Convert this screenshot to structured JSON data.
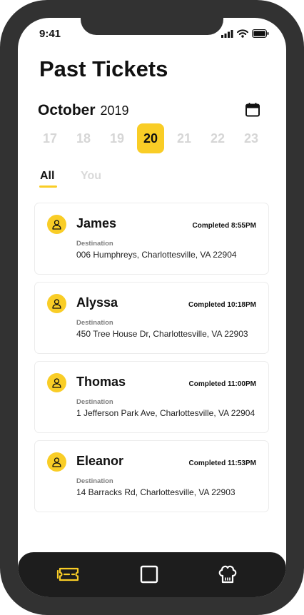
{
  "status_bar": {
    "time": "9:41"
  },
  "header": {
    "title": "Past Tickets"
  },
  "date_picker": {
    "month": "October",
    "year": "2019",
    "days": [
      "17",
      "18",
      "19",
      "20",
      "21",
      "22",
      "23"
    ],
    "selected_day": "20"
  },
  "tabs": [
    {
      "label": "All",
      "active": true
    },
    {
      "label": "You",
      "active": false
    }
  ],
  "tickets": [
    {
      "name": "James",
      "status": "Completed 8:55PM",
      "destination_label": "Destination",
      "destination": "006 Humphreys, Charlottesville, VA 22904"
    },
    {
      "name": "Alyssa",
      "status": "Completed 10:18PM",
      "destination_label": "Destination",
      "destination": "450 Tree House Dr, Charlottesville, VA 22903"
    },
    {
      "name": "Thomas",
      "status": "Completed 11:00PM",
      "destination_label": "Destination",
      "destination": "1 Jefferson Park Ave, Charlottesville, VA 22904"
    },
    {
      "name": "Eleanor",
      "status": "Completed 11:53PM",
      "destination_label": "Destination",
      "destination": "14 Barracks Rd, Charlottesville, VA 22903"
    }
  ],
  "bottom_nav": [
    {
      "icon": "ticket-icon",
      "active": true
    },
    {
      "icon": "square-icon",
      "active": false
    },
    {
      "icon": "chef-hat-icon",
      "active": false
    }
  ],
  "colors": {
    "accent": "#f9cd26",
    "device_frame": "#323232",
    "nav_background": "#1d1d1d",
    "inactive_text": "#d6d6d6"
  }
}
